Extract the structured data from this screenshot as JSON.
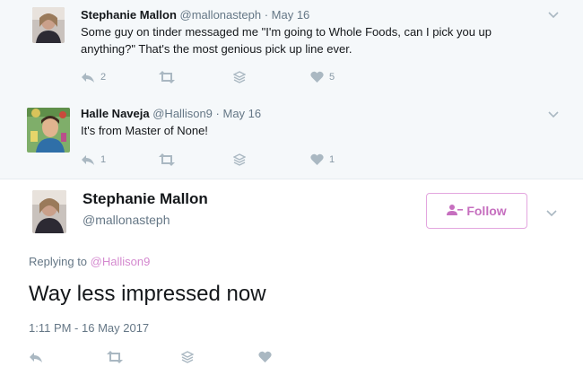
{
  "tweets": [
    {
      "name": "Stephanie Mallon",
      "handle": "@mallonasteph",
      "separator": "·",
      "date": "May 16",
      "text_line1": "Some guy on tinder messaged me \"I'm going to Whole Foods, can I pick you up",
      "text_line2": "anything?\" That's the most genious pick up line ever.",
      "reply_count": "2",
      "retweet_count": "",
      "like_count": "5"
    },
    {
      "name": "Halle Naveja",
      "handle": "@Hallison9",
      "separator": "·",
      "date": "May 16",
      "text_line1": "It's from Master of None!",
      "reply_count": "1",
      "retweet_count": "",
      "like_count": "1"
    }
  ],
  "main_tweet": {
    "name": "Stephanie Mallon",
    "handle": "@mallonasteph",
    "follow_label": "Follow",
    "replying_prefix": "Replying to",
    "replying_handle": "@Hallison9",
    "text": "Way less impressed now",
    "timestamp": "1:11 PM - 16 May 2017"
  },
  "icons": {
    "reply": "reply-icon",
    "retweet": "retweet-icon",
    "stack": "stack-icon",
    "like": "heart-icon",
    "more": "chevron-down-icon",
    "follow": "add-person-icon"
  },
  "colors": {
    "accent": "#c66fbf",
    "thread_line": "#e3a6df",
    "action_gray": "#aab8c2",
    "secondary_text": "#657786"
  }
}
